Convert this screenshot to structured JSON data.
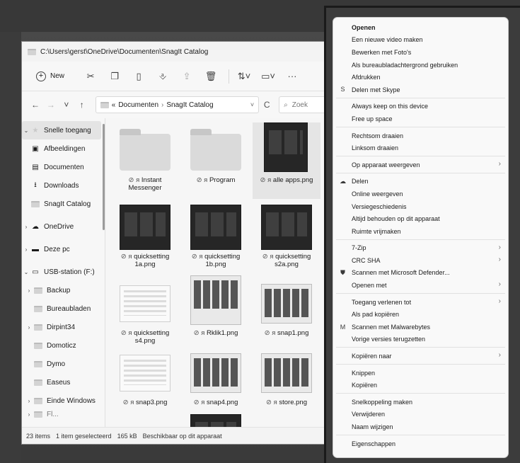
{
  "explorer": {
    "title": "C:\\Users\\gerst\\OneDrive\\Documenten\\SnagIt Catalog",
    "toolbar": {
      "new_label": "New"
    },
    "address": {
      "overflow": "«",
      "crumb1": "Documenten",
      "crumb_sep": "›",
      "crumb2": "SnagIt Catalog"
    },
    "search_placeholder": "Zoek",
    "nav_items": [
      {
        "label": "Snelle toegang"
      },
      {
        "label": "Afbeeldingen"
      },
      {
        "label": "Documenten"
      },
      {
        "label": "Downloads"
      },
      {
        "label": "SnagIt Catalog"
      },
      {
        "label": "OneDrive"
      },
      {
        "label": "Deze pc"
      },
      {
        "label": "USB-station (F:)"
      },
      {
        "label": "Backup"
      },
      {
        "label": "Bureaubladen"
      },
      {
        "label": "Dirpint34"
      },
      {
        "label": "Domoticz"
      },
      {
        "label": "Dymo"
      },
      {
        "label": "Easeus"
      },
      {
        "label": "Einde Windows"
      },
      {
        "label": "Fl..."
      }
    ],
    "files": [
      {
        "name": "Instant Messenger",
        "status": "⊘ ᴙ"
      },
      {
        "name": "Program",
        "status": "⊘ ᴙ"
      },
      {
        "name": "alle apps.png",
        "status": "⊘ ᴙ"
      },
      {
        "name": "quicksetting 1a.png",
        "status": "⊘ ᴙ"
      },
      {
        "name": "quicksetting 1b.png",
        "status": "⊘ ᴙ"
      },
      {
        "name": "quicksetting s2a.png",
        "status": "⊘ ᴙ"
      },
      {
        "name": "quicksetting s4.png",
        "status": "⊘ ᴙ"
      },
      {
        "name": "Rklik1.png",
        "status": "⊘ ᴙ"
      },
      {
        "name": "snap1.png",
        "status": "⊘ ᴙ"
      },
      {
        "name": "snap3.png",
        "status": "⊘ ᴙ"
      },
      {
        "name": "snap4.png",
        "status": "⊘ ᴙ"
      },
      {
        "name": "store.png",
        "status": "⊘ ᴙ"
      }
    ],
    "status": {
      "count": "23 items",
      "selected": "1 item geselecteerd",
      "size": "165 kB",
      "availability": "Beschikbaar op dit apparaat"
    }
  },
  "context_menu": {
    "items": [
      {
        "label": "Openen"
      },
      {
        "label": "Een nieuwe video maken"
      },
      {
        "label": "Bewerken met Foto's"
      },
      {
        "label": "Als bureaubladachtergrond gebruiken"
      },
      {
        "label": "Afdrukken"
      },
      {
        "label": "Delen met Skype"
      },
      {
        "label": "Always keep on this device"
      },
      {
        "label": "Free up space"
      },
      {
        "label": "Rechtsom draaien"
      },
      {
        "label": "Linksom draaien"
      },
      {
        "label": "Op apparaat weergeven"
      },
      {
        "label": "Delen"
      },
      {
        "label": "Online weergeven"
      },
      {
        "label": "Versiegeschiedenis"
      },
      {
        "label": "Altijd behouden op dit apparaat"
      },
      {
        "label": "Ruimte vrijmaken"
      },
      {
        "label": "7-Zip"
      },
      {
        "label": "CRC SHA"
      },
      {
        "label": "Scannen met Microsoft Defender..."
      },
      {
        "label": "Openen met"
      },
      {
        "label": "Toegang verlenen tot"
      },
      {
        "label": "Als pad kopiëren"
      },
      {
        "label": "Scannen met Malwarebytes"
      },
      {
        "label": "Vorige versies terugzetten"
      },
      {
        "label": "Kopiëren naar"
      },
      {
        "label": "Knippen"
      },
      {
        "label": "Kopiëren"
      },
      {
        "label": "Snelkoppeling maken"
      },
      {
        "label": "Verwijderen"
      },
      {
        "label": "Naam wijzigen"
      },
      {
        "label": "Eigenschappen"
      }
    ]
  }
}
